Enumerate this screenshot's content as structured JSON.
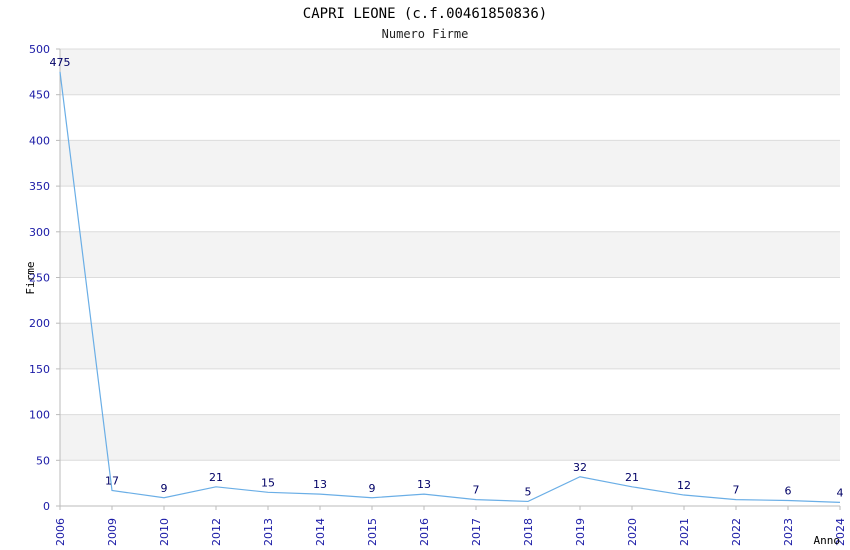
{
  "chart_data": {
    "type": "line",
    "title": "CAPRI LEONE (c.f.00461850836)",
    "subtitle": "Numero Firme",
    "xlabel": "Anno",
    "ylabel": "Firme",
    "x": [
      "2006",
      "2009",
      "2010",
      "2012",
      "2013",
      "2014",
      "2015",
      "2016",
      "2017",
      "2018",
      "2019",
      "2020",
      "2021",
      "2022",
      "2023",
      "2024"
    ],
    "values": [
      475,
      17,
      9,
      21,
      15,
      13,
      9,
      13,
      7,
      5,
      32,
      21,
      12,
      7,
      6,
      4
    ],
    "ylim": [
      0,
      500
    ],
    "yticks": [
      0,
      50,
      100,
      150,
      200,
      250,
      300,
      350,
      400,
      450,
      500
    ],
    "grid": true,
    "line_color": "#6aaee6",
    "band_color": "#f3f3f3"
  }
}
